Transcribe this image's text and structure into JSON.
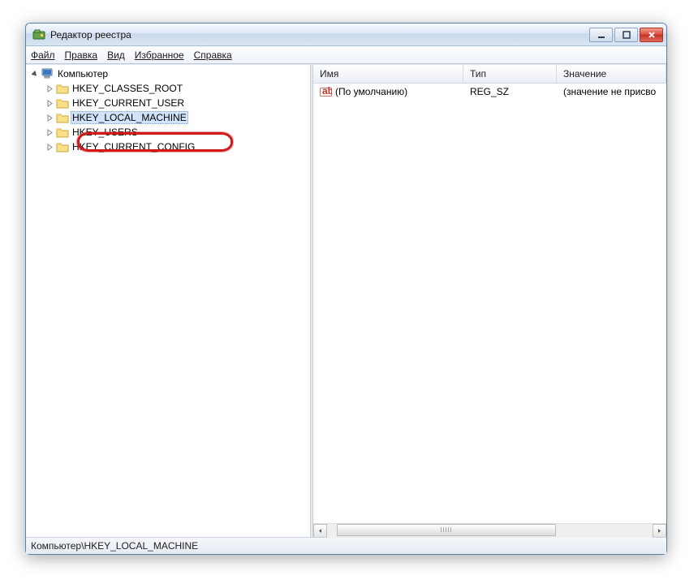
{
  "window": {
    "title": "Редактор реестра"
  },
  "menu": {
    "file": "Файл",
    "edit": "Правка",
    "view": "Вид",
    "fav": "Избранное",
    "help": "Справка"
  },
  "tree": {
    "root": {
      "label": "Компьютер"
    },
    "items": [
      {
        "label": "HKEY_CLASSES_ROOT"
      },
      {
        "label": "HKEY_CURRENT_USER"
      },
      {
        "label": "HKEY_LOCAL_MACHINE"
      },
      {
        "label": "HKEY_USERS"
      },
      {
        "label": "HKEY_CURRENT_CONFIG"
      }
    ]
  },
  "list": {
    "columns": {
      "name": "Имя",
      "type": "Тип",
      "value": "Значение"
    },
    "rows": [
      {
        "name": "(По умолчанию)",
        "type": "REG_SZ",
        "value": "(значение не присво"
      }
    ]
  },
  "status": {
    "path": "Компьютер\\HKEY_LOCAL_MACHINE"
  }
}
